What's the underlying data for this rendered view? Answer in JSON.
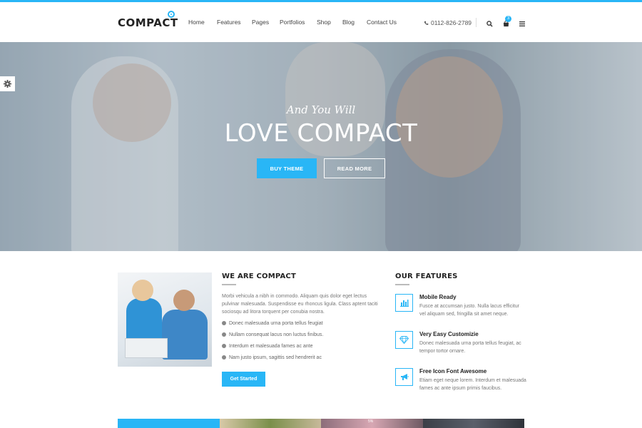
{
  "header": {
    "logo": "COMPACT",
    "nav": [
      "Home",
      "Features",
      "Pages",
      "Portfolios",
      "Shop",
      "Blog",
      "Contact Us"
    ],
    "phone": "0112-826-2789",
    "cart_count": "3"
  },
  "hero": {
    "subtitle": "And You Will",
    "title": "LOVE COMPACT",
    "buy_button": "BUY THEME",
    "read_button": "READ MORE"
  },
  "about": {
    "title": "WE ARE COMPACT",
    "body": "Morbi vehicula a nibh in commodo. Aliquam quis dolor eget lectus pulvinar malesuada. Suspendisse eu rhoncus ligula. Class aptent taciti sociosqu ad litora torquent per conubia nostra.",
    "checklist": [
      "Donec malesuada urna porta tellus feugiat",
      "Nullam consequat lacus non luctus finibus.",
      "Interdum et malesuada fames ac ante",
      "Nam justo ipsum, sagittis sed hendrerit ac"
    ],
    "button": "Get Started"
  },
  "features": {
    "title": "OUR FEATURES",
    "items": [
      {
        "title": "Mobile Ready",
        "desc": "Fusce at accumsan justo. Nulla lacus efficitur vel aliquam sed, fringilla sit amet neque.",
        "icon": "bar-chart-icon"
      },
      {
        "title": "Very Easy Customizie",
        "desc": "Donec malesuada urna porta tellus feugiat, ac tempor tortor ornare.",
        "icon": "diamond-icon"
      },
      {
        "title": "Free Icon Font Awesome",
        "desc": "Etiam eget neque lorem. Interdum et malesuada fames ac ante ipsum primis faucibus.",
        "icon": "megaphone-icon"
      }
    ]
  },
  "bottom_strip": {
    "label": "5%"
  },
  "colors": {
    "accent": "#29b6f6",
    "text_dark": "#222222",
    "text_muted": "#777777"
  }
}
